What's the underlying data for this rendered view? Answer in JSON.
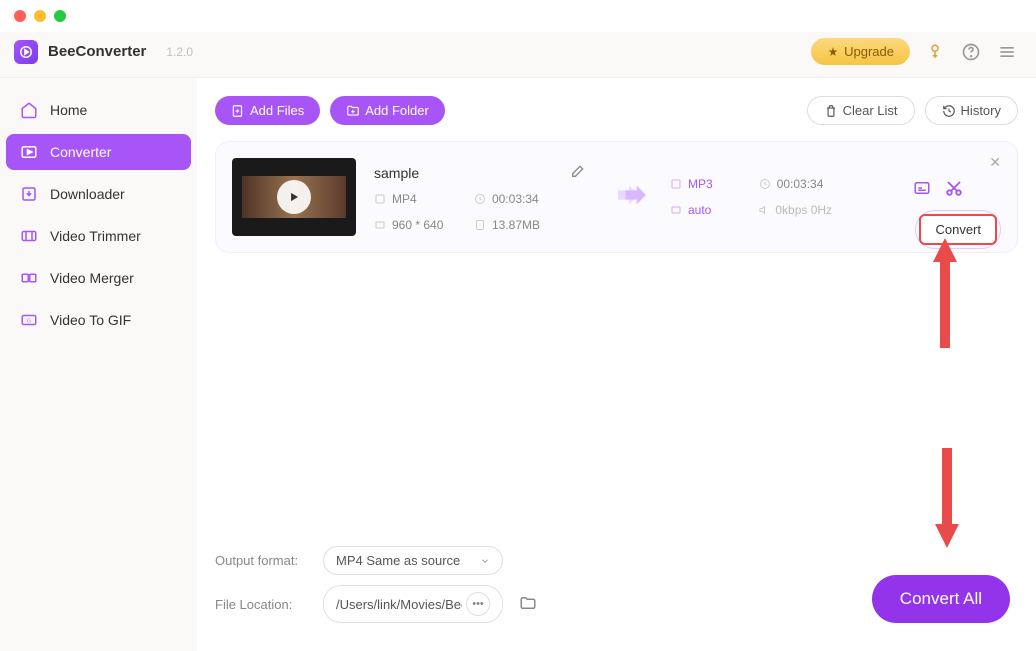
{
  "app": {
    "name": "BeeConverter",
    "version": "1.2.0"
  },
  "header": {
    "upgrade": "Upgrade"
  },
  "sidebar": {
    "items": [
      {
        "label": "Home"
      },
      {
        "label": "Converter"
      },
      {
        "label": "Downloader"
      },
      {
        "label": "Video Trimmer"
      },
      {
        "label": "Video Merger"
      },
      {
        "label": "Video To GIF"
      }
    ],
    "active_index": 1
  },
  "toolbar": {
    "add_files": "Add Files",
    "add_folder": "Add Folder",
    "clear_list": "Clear List",
    "history": "History"
  },
  "file": {
    "name": "sample",
    "in_format": "MP4",
    "duration": "00:03:34",
    "resolution": "960 * 640",
    "size": "13.87MB",
    "out_format": "MP3",
    "out_duration": "00:03:34",
    "out_quality": "auto",
    "out_audio": "0kbps 0Hz",
    "convert_label": "Convert"
  },
  "footer": {
    "output_format_label": "Output format:",
    "output_format_value": "MP4 Same as source",
    "file_location_label": "File Location:",
    "file_location_value": "/Users/link/Movies/BeeC",
    "convert_all": "Convert All"
  }
}
